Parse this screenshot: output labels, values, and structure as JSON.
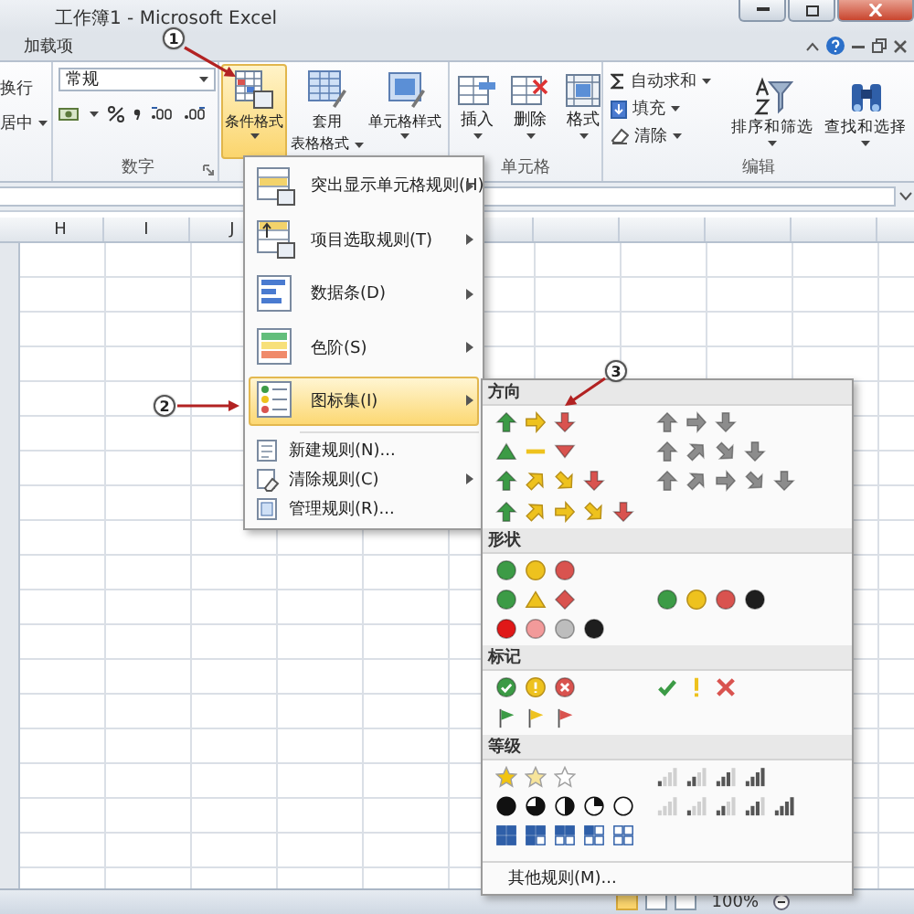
{
  "window": {
    "title": "工作簿1 - Microsoft Excel"
  },
  "ribbon_tabs": [
    {
      "label": "加载项",
      "selected": false
    }
  ],
  "ribbon": {
    "alignment": {
      "items": [
        "换行",
        "居中"
      ]
    },
    "number": {
      "format": "常规",
      "label": "数字"
    },
    "styles": {
      "buttons": [
        {
          "label_lines": [
            "条件格式"
          ],
          "selected": true
        },
        {
          "label_lines": [
            "套用",
            "表格格式"
          ],
          "selected": false
        },
        {
          "label_lines": [
            "单元格样式"
          ],
          "selected": false
        }
      ]
    },
    "cells": {
      "buttons": [
        "插入",
        "删除",
        "格式"
      ],
      "label": "单元格"
    },
    "editing": {
      "commands": [
        "自动求和",
        "填充",
        "清除"
      ],
      "buttons": [
        "排序和筛选",
        "查找和选择"
      ],
      "label": "编辑"
    }
  },
  "sheet": {
    "columns": [
      "H",
      "I",
      "J"
    ]
  },
  "conditional_format_menu": {
    "items": [
      {
        "kind": "large",
        "label": "突出显示单元格规则(H)",
        "submenu": true,
        "selected": false
      },
      {
        "kind": "large",
        "label": "项目选取规则(T)",
        "submenu": true,
        "selected": false
      },
      {
        "kind": "large",
        "label": "数据条(D)",
        "submenu": true,
        "selected": false
      },
      {
        "kind": "large",
        "label": "色阶(S)",
        "submenu": true,
        "selected": false
      },
      {
        "kind": "large",
        "label": "图标集(I)",
        "submenu": true,
        "selected": true
      },
      {
        "kind": "small",
        "label": "新建规则(N)...",
        "submenu": false,
        "selected": false
      },
      {
        "kind": "small",
        "label": "清除规则(C)",
        "submenu": true,
        "selected": false
      },
      {
        "kind": "small",
        "label": "管理规则(R)...",
        "submenu": false,
        "selected": false
      }
    ]
  },
  "icon_sets_menu": {
    "sections": [
      {
        "title": "方向",
        "rows": [
          [
            {
              "kind": "arrows3"
            },
            {
              "kind": "gray_arrows3"
            }
          ],
          [
            {
              "kind": "triangles3"
            },
            {
              "kind": "gray_arrows4"
            }
          ],
          [
            {
              "kind": "arrows4"
            },
            {
              "kind": "gray_arrows5"
            }
          ],
          [
            {
              "kind": "arrows5"
            }
          ]
        ]
      },
      {
        "title": "形状",
        "rows": [
          [
            {
              "kind": "lights3"
            }
          ],
          [
            {
              "kind": "signs3"
            },
            {
              "kind": "lights4"
            }
          ],
          [
            {
              "kind": "red_to_black4"
            }
          ]
        ]
      },
      {
        "title": "标记",
        "rows": [
          [
            {
              "kind": "symbols3_circled"
            },
            {
              "kind": "symbols3"
            }
          ],
          [
            {
              "kind": "flags3"
            }
          ]
        ]
      },
      {
        "title": "等级",
        "rows": [
          [
            {
              "kind": "stars3"
            },
            {
              "kind": "ratings4"
            }
          ],
          [
            {
              "kind": "quarters5"
            },
            {
              "kind": "ratings5"
            }
          ],
          [
            {
              "kind": "boxes5"
            }
          ]
        ]
      }
    ],
    "footer": "其他规则(M)..."
  },
  "annotations": [
    {
      "label": "1"
    },
    {
      "label": "2"
    },
    {
      "label": "3"
    }
  ],
  "status_bar": {
    "zoom": "100%"
  }
}
